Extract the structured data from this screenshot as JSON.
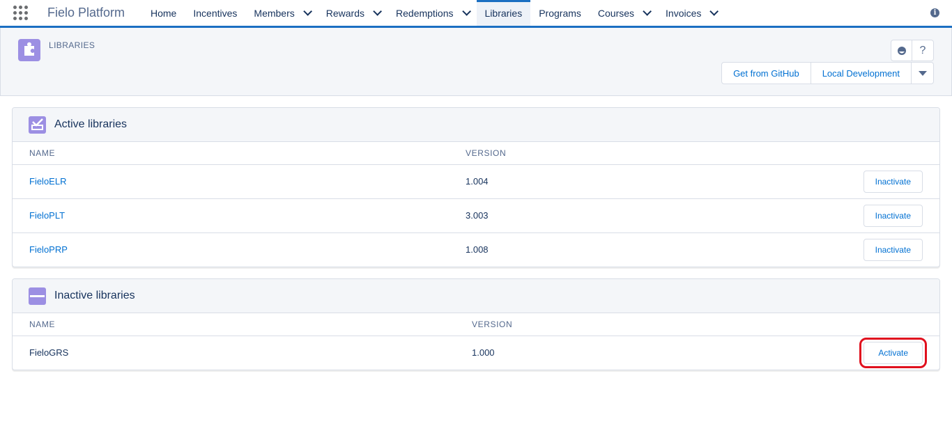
{
  "nav": {
    "app_name": "Fielo Platform",
    "items": [
      {
        "label": "Home"
      },
      {
        "label": "Incentives"
      },
      {
        "label": "Members"
      },
      {
        "label": "Rewards"
      },
      {
        "label": "Redemptions"
      },
      {
        "label": "Libraries"
      },
      {
        "label": "Programs"
      },
      {
        "label": "Courses"
      },
      {
        "label": "Invoices"
      }
    ]
  },
  "header": {
    "title": "LIBRARIES",
    "help_label": "?",
    "btn_github": "Get from GitHub",
    "btn_local": "Local Development"
  },
  "active": {
    "title": "Active libraries",
    "col_name": "NAME",
    "col_version": "VERSION",
    "rows": [
      {
        "name": "FieloELR",
        "version": "1.004",
        "action": "Inactivate"
      },
      {
        "name": "FieloPLT",
        "version": "3.003",
        "action": "Inactivate"
      },
      {
        "name": "FieloPRP",
        "version": "1.008",
        "action": "Inactivate"
      }
    ]
  },
  "inactive": {
    "title": "Inactive libraries",
    "col_name": "NAME",
    "col_version": "VERSION",
    "rows": [
      {
        "name": "FieloGRS",
        "version": "1.000",
        "action": "Activate"
      }
    ]
  },
  "colors": {
    "brand_blue": "#1b6fc2",
    "link_blue": "#0070d2",
    "icon_purple": "#9c8fe3",
    "highlight_red": "#e0101e"
  }
}
